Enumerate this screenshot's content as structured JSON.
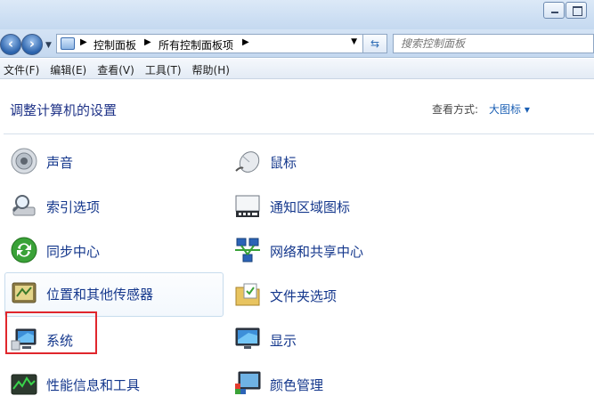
{
  "address": {
    "crumbs": [
      "控制面板",
      "所有控制面板项"
    ]
  },
  "search": {
    "placeholder": "搜索控制面板"
  },
  "menu": [
    "文件(F)",
    "编辑(E)",
    "查看(V)",
    "工具(T)",
    "帮助(H)"
  ],
  "content": {
    "title": "调整计算机的设置",
    "view_by_label": "查看方式:",
    "view_by_value": "大图标 ▾"
  },
  "items": [
    {
      "label": "声音",
      "icon": "speaker-icon"
    },
    {
      "label": "鼠标",
      "icon": "mouse-icon"
    },
    {
      "label": "索引选项",
      "icon": "index-search-icon"
    },
    {
      "label": "通知区域图标",
      "icon": "notification-area-icon"
    },
    {
      "label": "同步中心",
      "icon": "sync-center-icon"
    },
    {
      "label": "网络和共享中心",
      "icon": "network-icon"
    },
    {
      "label": "位置和其他传感器",
      "icon": "sensor-icon"
    },
    {
      "label": "文件夹选项",
      "icon": "folder-options-icon"
    },
    {
      "label": "系统",
      "icon": "computer-icon"
    },
    {
      "label": "显示",
      "icon": "display-icon"
    },
    {
      "label": "性能信息和工具",
      "icon": "performance-icon"
    },
    {
      "label": "颜色管理",
      "icon": "color-management-icon"
    }
  ],
  "colors": {
    "link": "#14378c",
    "title": "#1e3287",
    "highlight": "#e0262c"
  }
}
